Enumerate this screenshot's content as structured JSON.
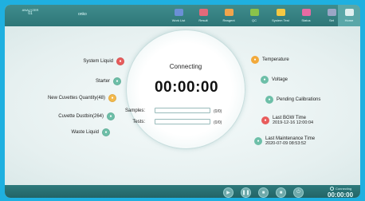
{
  "topbar": {
    "device_line1": "ANALYZER",
    "device_line2": "01",
    "user": "onko",
    "nav": [
      {
        "label": "Work List",
        "color": "#6b8fd6"
      },
      {
        "label": "Result",
        "color": "#e26a7a"
      },
      {
        "label": "Reagent",
        "color": "#f2a44b"
      },
      {
        "label": "QC",
        "color": "#8bc34a"
      },
      {
        "label": "System Test",
        "color": "#f5c842"
      },
      {
        "label": "Status",
        "color": "#e66ba3"
      },
      {
        "label": "Set",
        "color": "#9aa6c6"
      },
      {
        "label": "Home",
        "color": "#e0f0f0"
      }
    ]
  },
  "main": {
    "status": "Connecting",
    "timer": "00:00:00",
    "samples_label": "Samples:",
    "samples_count": "(0/0)",
    "tests_label": "Tests:",
    "tests_count": "(0/0)",
    "left_items": [
      {
        "label": "System Liquid",
        "icon": "liquid-icon",
        "color": "#e85c5c"
      },
      {
        "label": "Starter",
        "icon": "starter-icon",
        "color": "#6dbfa8"
      },
      {
        "label": "New Cuvettes Quantity(48)",
        "icon": "cuvette-icon",
        "color": "#f3b94b"
      },
      {
        "label": "Cuvette Dustbin(264)",
        "icon": "dustbin-icon",
        "color": "#6dbfa8"
      },
      {
        "label": "Waste Liquid",
        "icon": "waste-icon",
        "color": "#6dbfa8"
      }
    ],
    "right_items": [
      {
        "label": "Temperature",
        "sub": "",
        "icon": "temperature-icon",
        "color": "#f2a93b"
      },
      {
        "label": "Voltage",
        "sub": "",
        "icon": "voltage-icon",
        "color": "#6dbfa8"
      },
      {
        "label": "Pending Calibrations",
        "sub": "",
        "icon": "calibration-icon",
        "color": "#6dbfa8"
      },
      {
        "label": "Last BGW Time",
        "sub": "2019-12-16 12:00:04",
        "icon": "bgw-icon",
        "color": "#e85c5c"
      },
      {
        "label": "Last Maintenance Time",
        "sub": "2020-07-09 08:53:52",
        "icon": "maintenance-icon",
        "color": "#6dbfa8"
      }
    ]
  },
  "bottombar": {
    "connection_label": "Connecting",
    "time": "00:00:00"
  }
}
